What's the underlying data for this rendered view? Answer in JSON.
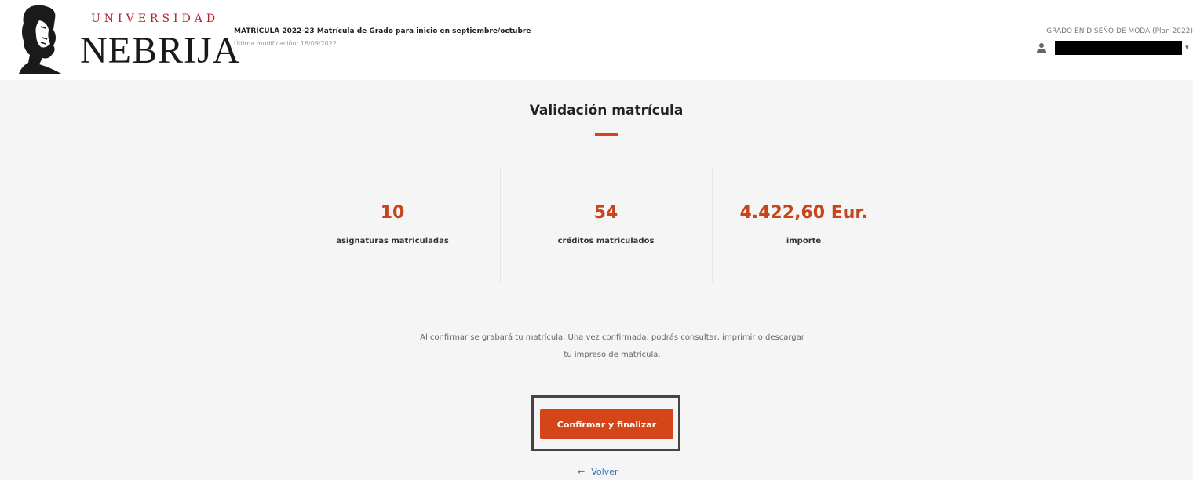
{
  "header": {
    "logo": {
      "top_text": "UNIVERSIDAD",
      "main_text": "NEBRIJA"
    },
    "course_title": "MATRÍCULA 2022-23 Matrícula de Grado para inicio en septiembre/octubre",
    "last_modified": "Última modificación: 16/09/2022",
    "degree": "GRADO EN DISEÑO DE MODA (Plan 2022)",
    "user": {
      "icon": "user-icon",
      "name": "",
      "caret": "▾"
    }
  },
  "main": {
    "title": "Validación matrícula",
    "stats": [
      {
        "value": "10",
        "label": "asignaturas matriculadas"
      },
      {
        "value": "54",
        "label": "créditos matriculados"
      },
      {
        "value": "4.422,60 Eur.",
        "label": "importe"
      }
    ],
    "info_line1": "Al confirmar se grabará tu matrícula. Una vez confirmada, podrás consultar, imprimir o descargar",
    "info_line2": "tu impreso de matrícula.",
    "confirm_label": "Confirmar y finalizar",
    "back_label": "Volver",
    "back_icon": "←"
  },
  "colors": {
    "accent": "#d4451a",
    "link": "#3d6fb4"
  }
}
